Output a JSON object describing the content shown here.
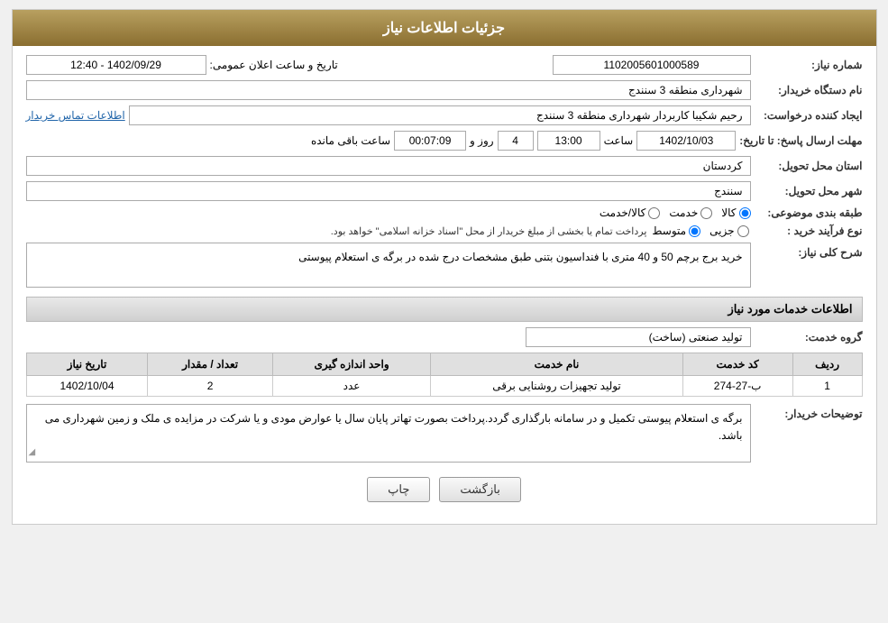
{
  "header": {
    "title": "جزئیات اطلاعات نیاز"
  },
  "fields": {
    "need_number_label": "شماره نیاز:",
    "need_number_value": "1102005601000589",
    "buyer_org_label": "نام دستگاه خریدار:",
    "buyer_org_value": "شهرداری منطقه 3 سنندج",
    "creator_label": "ایجاد کننده درخواست:",
    "creator_value": "رحیم شکیبا کاربردار شهرداری منطقه 3 سنندج",
    "contact_link": "اطلاعات تماس خریدار",
    "deadline_label": "مهلت ارسال پاسخ: تا تاریخ:",
    "deadline_date": "1402/10/03",
    "deadline_time_label": "ساعت",
    "deadline_time_value": "13:00",
    "deadline_days_label": "روز و",
    "deadline_days_value": "4",
    "deadline_remain_label": "ساعت باقی مانده",
    "deadline_remain_value": "00:07:09",
    "province_label": "استان محل تحویل:",
    "province_value": "کردستان",
    "city_label": "شهر محل تحویل:",
    "city_value": "سنندج",
    "category_label": "طبقه بندی موضوعی:",
    "category_options": [
      {
        "label": "کالا",
        "value": "kala",
        "selected": true
      },
      {
        "label": "خدمت",
        "value": "khedmat",
        "selected": false
      },
      {
        "label": "کالا/خدمت",
        "value": "kala_khedmat",
        "selected": false
      }
    ],
    "purchase_type_label": "نوع فرآیند خرید :",
    "purchase_type_options": [
      {
        "label": "جزیی",
        "value": "jozei",
        "selected": false
      },
      {
        "label": "متوسط",
        "value": "motavaset",
        "selected": true
      },
      {
        "label": "text_note",
        "value": "",
        "selected": false
      }
    ],
    "purchase_type_note": "پرداخت تمام یا بخشی از مبلغ خریدار از محل \"اسناد خزانه اسلامی\" خواهد بود.",
    "narration_label": "شرح کلی نیاز:",
    "narration_value": "خرید برج برچم 50 و 40 متری با فنداسیون بتنی طبق مشخصات درج شده در برگه ی استعلام پیوستی"
  },
  "services_section": {
    "title": "اطلاعات خدمات مورد نیاز",
    "group_label": "گروه خدمت:",
    "group_value": "تولید صنعتی (ساخت)",
    "table": {
      "columns": [
        "ردیف",
        "کد خدمت",
        "نام خدمت",
        "واحد اندازه گیری",
        "تعداد / مقدار",
        "تاریخ نیاز"
      ],
      "rows": [
        {
          "row_num": "1",
          "service_code": "ب-27-274",
          "service_name": "تولید تجهیزات روشنایی برقی",
          "unit": "عدد",
          "quantity": "2",
          "need_date": "1402/10/04"
        }
      ]
    }
  },
  "buyer_notes_label": "توضیحات خریدار:",
  "buyer_notes_value": "برگه ی استعلام پیوستی تکمیل و در سامانه بارگذاری گردد.پرداخت بصورت تهاتر پایان سال یا عوارض مودی و یا شرکت در مزایده ی ملک و زمین شهرداری می باشد.",
  "buttons": {
    "print": "چاپ",
    "back": "بازگشت"
  }
}
